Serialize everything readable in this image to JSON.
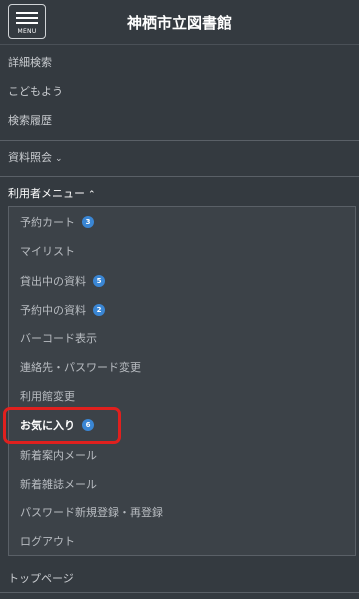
{
  "header": {
    "title": "神栖市立図書館",
    "menu_label": "MENU"
  },
  "top_links": [
    "詳細検索",
    "こどもよう",
    "検索履歴"
  ],
  "reference": {
    "label": "資料照会",
    "chevron": "chevron-down-icon"
  },
  "user_menu": {
    "label": "利用者メニュー",
    "chevron": "chevron-up-icon",
    "items": [
      {
        "label": "予約カート",
        "badge": "3"
      },
      {
        "label": "マイリスト",
        "badge": null
      },
      {
        "label": "貸出中の資料",
        "badge": "5"
      },
      {
        "label": "予約中の資料",
        "badge": "2"
      },
      {
        "label": "バーコード表示",
        "badge": null
      },
      {
        "label": "連絡先・パスワード変更",
        "badge": null
      },
      {
        "label": "利用館変更",
        "badge": null
      },
      {
        "label": "お気に入り",
        "badge": "6",
        "highlighted": true
      },
      {
        "label": "新着案内メール",
        "badge": null
      },
      {
        "label": "新着雑誌メール",
        "badge": null
      },
      {
        "label": "パスワード新規登録・再登録",
        "badge": null
      },
      {
        "label": "ログアウト",
        "badge": null
      }
    ]
  },
  "footer_link": "トップページ",
  "colors": {
    "background": "#343a40",
    "badge": "#3a86d4",
    "highlight": "#e0201e"
  }
}
